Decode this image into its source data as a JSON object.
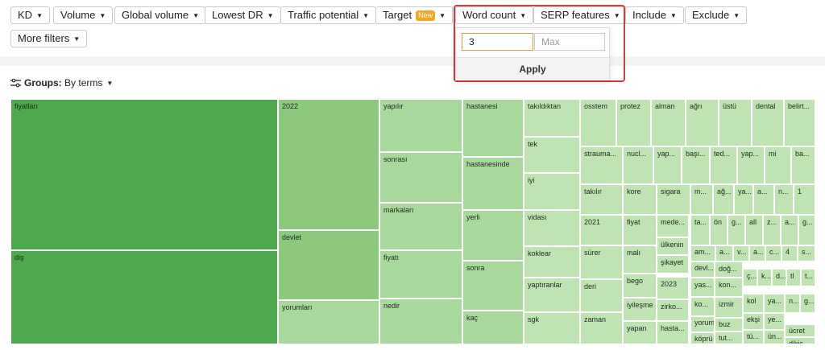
{
  "filters": {
    "kd": "KD",
    "volume": "Volume",
    "global_volume": "Global volume",
    "lowest_dr": "Lowest DR",
    "traffic_potential": "Traffic potential",
    "target": "Target",
    "target_badge": "New",
    "word_count": "Word count",
    "serp_features": "SERP features",
    "include": "Include",
    "exclude": "Exclude",
    "more_filters": "More filters"
  },
  "word_count_dropdown": {
    "min_value": "3",
    "max_placeholder": "Max",
    "apply_label": "Apply"
  },
  "groups": {
    "label": "Groups:",
    "value": "By terms"
  },
  "colors": {
    "shade1": "#4ea84d",
    "shade2": "#8cc97e",
    "shade3": "#a9d89c",
    "shade4": "#bfe3b3",
    "highlight_border": "#d93a3a",
    "input_focus_border": "#f29a3a"
  },
  "treemap": {
    "terms": [
      "fiyatları",
      "diş",
      "2022",
      "devlet",
      "yorumları",
      "yapılır",
      "sonrası",
      "markaları",
      "fiyatı",
      "nedir",
      "hastanesi",
      "hastanesinde",
      "yerli",
      "sonra",
      "kaç",
      "takıldıktan",
      "tek",
      "iyi",
      "vidası",
      "koklear",
      "yaptıranlar",
      "sgk",
      "osstem",
      "protez",
      "alman",
      "ağrı",
      "üstü",
      "dental",
      "belirt...",
      "strauma...",
      "nucl...",
      "yap...",
      "başı...",
      "ted...",
      "yap...",
      "mi",
      "ba...",
      "takılır",
      "kore",
      "sigara",
      "m...",
      "ağ...",
      "ya...",
      "a...",
      "n...",
      "1",
      "2021",
      "fiyat",
      "mede...",
      "ta...",
      "ön",
      "g...",
      "all",
      "z...",
      "a...",
      "g...",
      "ülkenin",
      "am...",
      "a...",
      "v...",
      "a...",
      "c...",
      "4",
      "s...",
      "sürer",
      "malı",
      "şikayet",
      "devl...",
      "doğ...",
      "ç...",
      "k...",
      "d...",
      "tl",
      "t...",
      "bego",
      "2023",
      "yas...",
      "kon...",
      "deri",
      "iyileşme",
      "ko...",
      "kol",
      "ya...",
      "n...",
      "g...",
      "zirko...",
      "izmir",
      "zaman",
      "yapan",
      "hasta...",
      "yorum",
      "buz",
      "ekşi",
      "ye...",
      "köprü",
      "tut...",
      "tü...",
      "ün...",
      "ücret",
      "dikiş..."
    ]
  }
}
